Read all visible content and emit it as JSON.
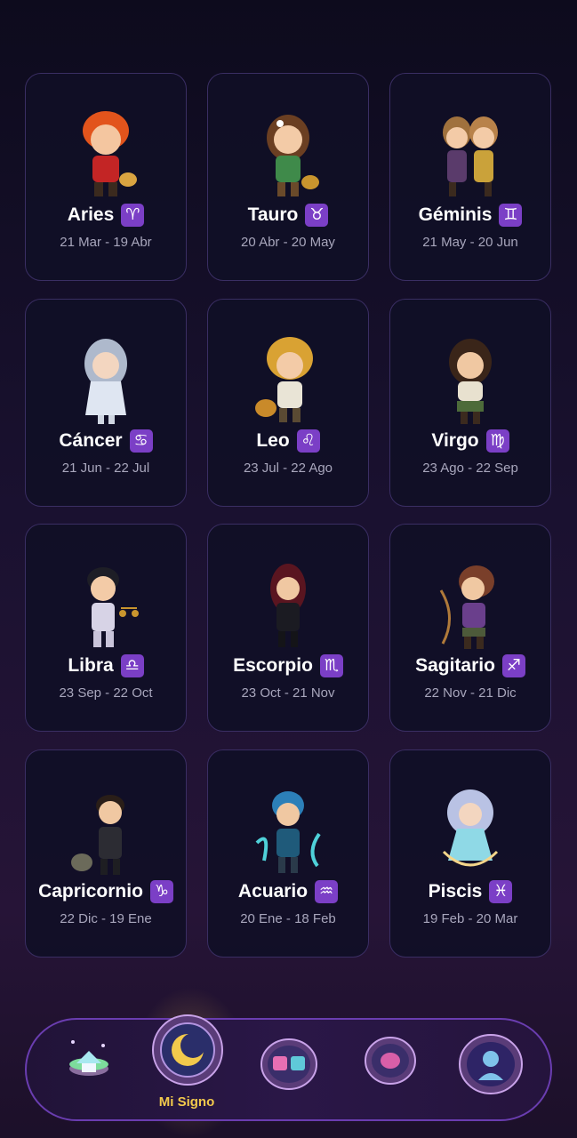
{
  "signs": [
    {
      "name": "Aries",
      "symbol": "♈",
      "dates": "21 Mar - 19 Abr"
    },
    {
      "name": "Tauro",
      "symbol": "♉",
      "dates": "20 Abr - 20 May"
    },
    {
      "name": "Géminis",
      "symbol": "♊",
      "dates": "21 May - 20 Jun"
    },
    {
      "name": "Cáncer",
      "symbol": "♋",
      "dates": "21 Jun - 22 Jul"
    },
    {
      "name": "Leo",
      "symbol": "♌",
      "dates": "23 Jul - 22 Ago"
    },
    {
      "name": "Virgo",
      "symbol": "♍",
      "dates": "23 Ago - 22 Sep"
    },
    {
      "name": "Libra",
      "symbol": "♎",
      "dates": "23 Sep - 22 Oct"
    },
    {
      "name": "Escorpio",
      "symbol": "♏",
      "dates": "23 Oct - 21 Nov"
    },
    {
      "name": "Sagitario",
      "symbol": "♐",
      "dates": "22 Nov - 21 Dic"
    },
    {
      "name": "Capricornio",
      "symbol": "♑",
      "dates": "22 Dic - 19 Ene"
    },
    {
      "name": "Acuario",
      "symbol": "♒",
      "dates": "20 Ene - 18 Feb"
    },
    {
      "name": "Piscis",
      "symbol": "♓",
      "dates": "19 Feb - 20 Mar"
    }
  ],
  "navbar": {
    "active_label": "Mi Signo",
    "items": [
      "home-island-icon",
      "my-sign-zodiac-icon",
      "compatibility-puzzle-icon",
      "mind-brain-icon",
      "profile-silhouette-icon"
    ]
  },
  "colors": {
    "card_bg": "#100f26",
    "card_border": "#3a2e63",
    "symbol_bg": "#7b3fc6",
    "active_label": "#f2c94c",
    "nav_border": "#6a3db0"
  }
}
